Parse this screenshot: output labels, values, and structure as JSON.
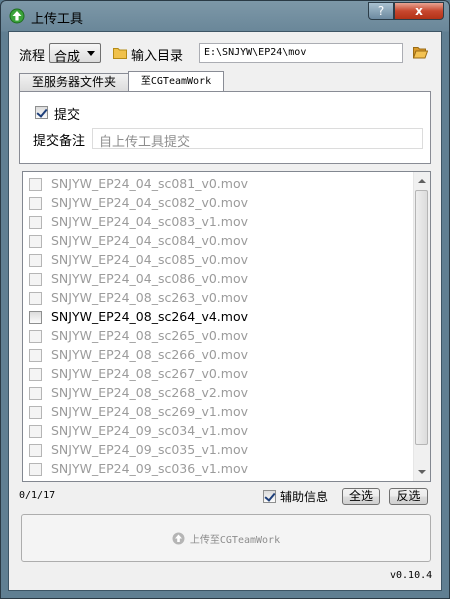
{
  "window": {
    "title": "上传工具",
    "help_label": "?",
    "close_label": "x"
  },
  "toolbar": {
    "flow_label": "流程",
    "flow_value": "合成",
    "input_dir_label": "输入目录",
    "path_value": "E:\\SNJYW\\EP24\\mov"
  },
  "tabs": [
    {
      "label": "至服务器文件夹",
      "selected": false
    },
    {
      "label": "至CGTeamWork",
      "selected": true
    }
  ],
  "submit": {
    "label": "提交",
    "checked": true
  },
  "note": {
    "label": "提交备注",
    "placeholder": "自上传工具提交"
  },
  "files": [
    {
      "name": "SNJYW_EP24_04_sc081_v0.mov",
      "checked": false,
      "enabled": false
    },
    {
      "name": "SNJYW_EP24_04_sc082_v0.mov",
      "checked": false,
      "enabled": false
    },
    {
      "name": "SNJYW_EP24_04_sc083_v1.mov",
      "checked": false,
      "enabled": false
    },
    {
      "name": "SNJYW_EP24_04_sc084_v0.mov",
      "checked": false,
      "enabled": false
    },
    {
      "name": "SNJYW_EP24_04_sc085_v0.mov",
      "checked": false,
      "enabled": false
    },
    {
      "name": "SNJYW_EP24_04_sc086_v0.mov",
      "checked": false,
      "enabled": false
    },
    {
      "name": "SNJYW_EP24_08_sc263_v0.mov",
      "checked": false,
      "enabled": false
    },
    {
      "name": "SNJYW_EP24_08_sc264_v4.mov",
      "checked": false,
      "enabled": true
    },
    {
      "name": "SNJYW_EP24_08_sc265_v0.mov",
      "checked": false,
      "enabled": false
    },
    {
      "name": "SNJYW_EP24_08_sc266_v0.mov",
      "checked": false,
      "enabled": false
    },
    {
      "name": "SNJYW_EP24_08_sc267_v0.mov",
      "checked": false,
      "enabled": false
    },
    {
      "name": "SNJYW_EP24_08_sc268_v2.mov",
      "checked": false,
      "enabled": false
    },
    {
      "name": "SNJYW_EP24_08_sc269_v1.mov",
      "checked": false,
      "enabled": false
    },
    {
      "name": "SNJYW_EP24_09_sc034_v1.mov",
      "checked": false,
      "enabled": false
    },
    {
      "name": "SNJYW_EP24_09_sc035_v1.mov",
      "checked": false,
      "enabled": false
    },
    {
      "name": "SNJYW_EP24_09_sc036_v1.mov",
      "checked": false,
      "enabled": false
    }
  ],
  "footer": {
    "count": "0/1/17",
    "aux_label": "辅助信息",
    "aux_checked": true,
    "select_all": "全选",
    "invert": "反选",
    "upload_label": "上传至CGTeamWork",
    "version": "v0.10.4"
  },
  "colors": {
    "title_icon": "#3aa33a",
    "folder": "#f0c14b",
    "disabled_text": "#9b9b9b"
  },
  "icons": [
    "app-upload-icon",
    "folder-icon",
    "folder-browse-icon",
    "upload-arrow-icon"
  ]
}
